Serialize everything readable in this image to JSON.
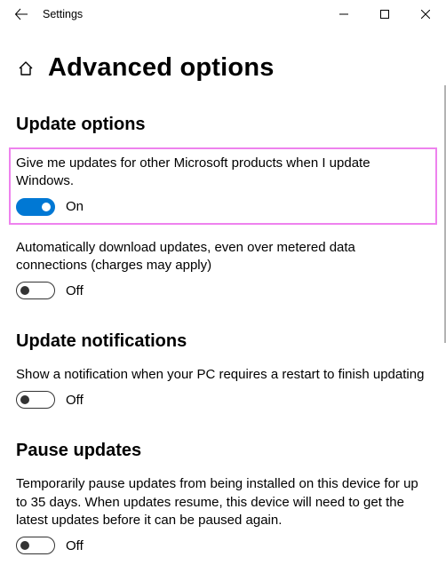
{
  "window": {
    "title": "Settings"
  },
  "page": {
    "title": "Advanced options"
  },
  "sections": {
    "update_options": {
      "heading": "Update options",
      "setting1": {
        "desc": "Give me updates for other Microsoft products when I update Windows.",
        "state_label": "On",
        "on": true
      },
      "setting2": {
        "desc": "Automatically download updates, even over metered data connections (charges may apply)",
        "state_label": "Off",
        "on": false
      }
    },
    "update_notifications": {
      "heading": "Update notifications",
      "setting1": {
        "desc": "Show a notification when your PC requires a restart to finish updating",
        "state_label": "Off",
        "on": false
      }
    },
    "pause_updates": {
      "heading": "Pause updates",
      "setting1": {
        "desc": "Temporarily pause updates from being installed on this device for up to 35 days. When updates resume, this device will need to get the latest updates before it can be paused again.",
        "state_label": "Off",
        "on": false
      }
    }
  }
}
